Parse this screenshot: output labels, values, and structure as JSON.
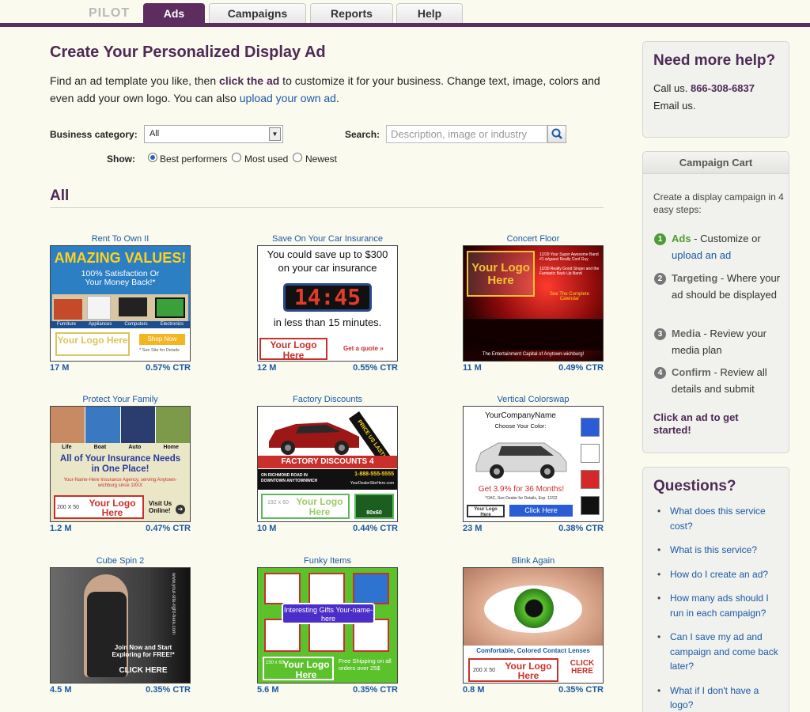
{
  "nav": {
    "brand": "PILOT",
    "tabs": [
      {
        "label": "Ads",
        "active": true
      },
      {
        "label": "Campaigns",
        "active": false
      },
      {
        "label": "Reports",
        "active": false
      },
      {
        "label": "Help",
        "active": false
      }
    ]
  },
  "page": {
    "title": "Create Your Personalized Display Ad",
    "intro_1": "Find an ad template you like, then ",
    "intro_bold": "click the ad",
    "intro_2": " to customize it for your business. Change text, image, colors and even add your own logo. You can also ",
    "intro_link": "upload your own ad",
    "intro_end": "."
  },
  "filters": {
    "category_label": "Business category:",
    "category_value": "All",
    "search_label": "Search:",
    "search_placeholder": "Description, image or industry",
    "show_label": "Show:",
    "show_options": [
      {
        "label": "Best performers",
        "selected": true
      },
      {
        "label": "Most used",
        "selected": false
      },
      {
        "label": "Newest",
        "selected": false
      }
    ]
  },
  "section_title": "All",
  "ads": [
    {
      "name": "Rent To Own II",
      "views": "17 M",
      "ctr": "0.57% CTR",
      "headline": "AMAZING VALUES!",
      "sub": "100% Satisfaction Or Your Money Back!*",
      "cats": [
        "Furniture",
        "Appliances",
        "Computers",
        "Electronics"
      ],
      "logo": "Your Logo Here",
      "btn": "Shop Now",
      "fine": "* See Site for Details"
    },
    {
      "name": "Save On Your Car Insurance",
      "views": "12 M",
      "ctr": "0.55% CTR",
      "line1": "You could save up to $300 on your car insurance",
      "clock": "14:45",
      "line2": "in less than 15 minutes.",
      "logo": "Your Logo Here",
      "size": "150 x 60",
      "cta": "Get a quote »"
    },
    {
      "name": "Concert Floor",
      "views": "11 M",
      "ctr": "0.49% CTR",
      "logo": "Your Logo Here",
      "size": "150 x 113",
      "cal": "See The Complete Calendar",
      "footer": "The Entertainment Capital of Anytown-wichburg!"
    },
    {
      "name": "Protect Your Family",
      "views": "1.2 M",
      "ctr": "0.47% CTR",
      "cats": [
        "Life",
        "Boat",
        "Auto",
        "Home"
      ],
      "headline": "All of Your Insurance Needs in One Place!",
      "agency": "Your-Name-Here Insurance Agency, serving Anytown-wichburg since 19XX",
      "size": "200 X 50",
      "logo": "Your Logo Here",
      "visit": "Visit Us Online!"
    },
    {
      "name": "Factory Discounts",
      "views": "10 M",
      "ctr": "0.44% CTR",
      "banner": "FACTORY DISCOUNTS 4 EVERYONE!",
      "price": "PRICE US LAST!",
      "phone": "1-888-555-5555",
      "site": "YourDealerSiteHere.com",
      "addr": "ON RICHMOND ROAD IN DOWNTOWN ANYTOWNWICH",
      "size": "192 x 60",
      "logo": "Your Logo Here",
      "mfr": "80x60"
    },
    {
      "name": "Vertical Colorswap",
      "views": "23 M",
      "ctr": "0.38% CTR",
      "company": "YourCompanyName",
      "choose": "Choose Your Color:",
      "offer": "Get 3.9% for 36 Months!",
      "fine": "*OAC, See Dealer for Details, Exp. 12/22",
      "logo": "Your Logo Here",
      "cta": "Click Here"
    },
    {
      "name": "Cube Spin 2",
      "views": "4.5 M",
      "ctr": "0.35% CTR",
      "text": "Join Now and Start Exploring for FREE!*",
      "cta": "CLICK HERE",
      "url": "www.your-site-right-here.com"
    },
    {
      "name": "Funky Items",
      "views": "5.6 M",
      "ctr": "0.35% CTR",
      "banner": "Interesting Gifts Your-name-here",
      "logo": "Your Logo Here",
      "size": "150 x 60",
      "ship": "Free Shipping on all orders over 25$"
    },
    {
      "name": "Blink Again",
      "views": "0.8 M",
      "ctr": "0.35% CTR",
      "line": "Comfortable, Colored Contact Lenses",
      "size": "200 X 50",
      "logo": "Your Logo Here",
      "cta": "CLICK HERE"
    }
  ],
  "help": {
    "title": "Need more help?",
    "call": "Call us. ",
    "phone": "866-308-6837",
    "email": "Email us."
  },
  "cart": {
    "title": "Campaign Cart",
    "intro": "Create a display campaign in 4 easy steps:",
    "steps": [
      {
        "num": "1",
        "name": "Ads",
        "text": " - Customize or ",
        "link": "upload an ad"
      },
      {
        "num": "2",
        "name": "Targeting",
        "text": " - Where your ad should be displayed"
      },
      {
        "num": "3",
        "name": "Media",
        "text": " - Review your media plan"
      },
      {
        "num": "4",
        "name": "Confirm",
        "text": " - Review all details and submit"
      }
    ],
    "cta": "Click an ad to get started!"
  },
  "questions": {
    "title": "Questions?",
    "items": [
      "What does this service cost?",
      "What is this service?",
      "How do I create an ad?",
      "How many ads should I run in each campaign?",
      "Can I save my ad and campaign and come back later?",
      "What if I don't have a logo?"
    ]
  },
  "colors": {
    "brand_purple": "#5c2d5e",
    "link_blue": "#1a5aa6",
    "step_green": "#4f9b35"
  }
}
